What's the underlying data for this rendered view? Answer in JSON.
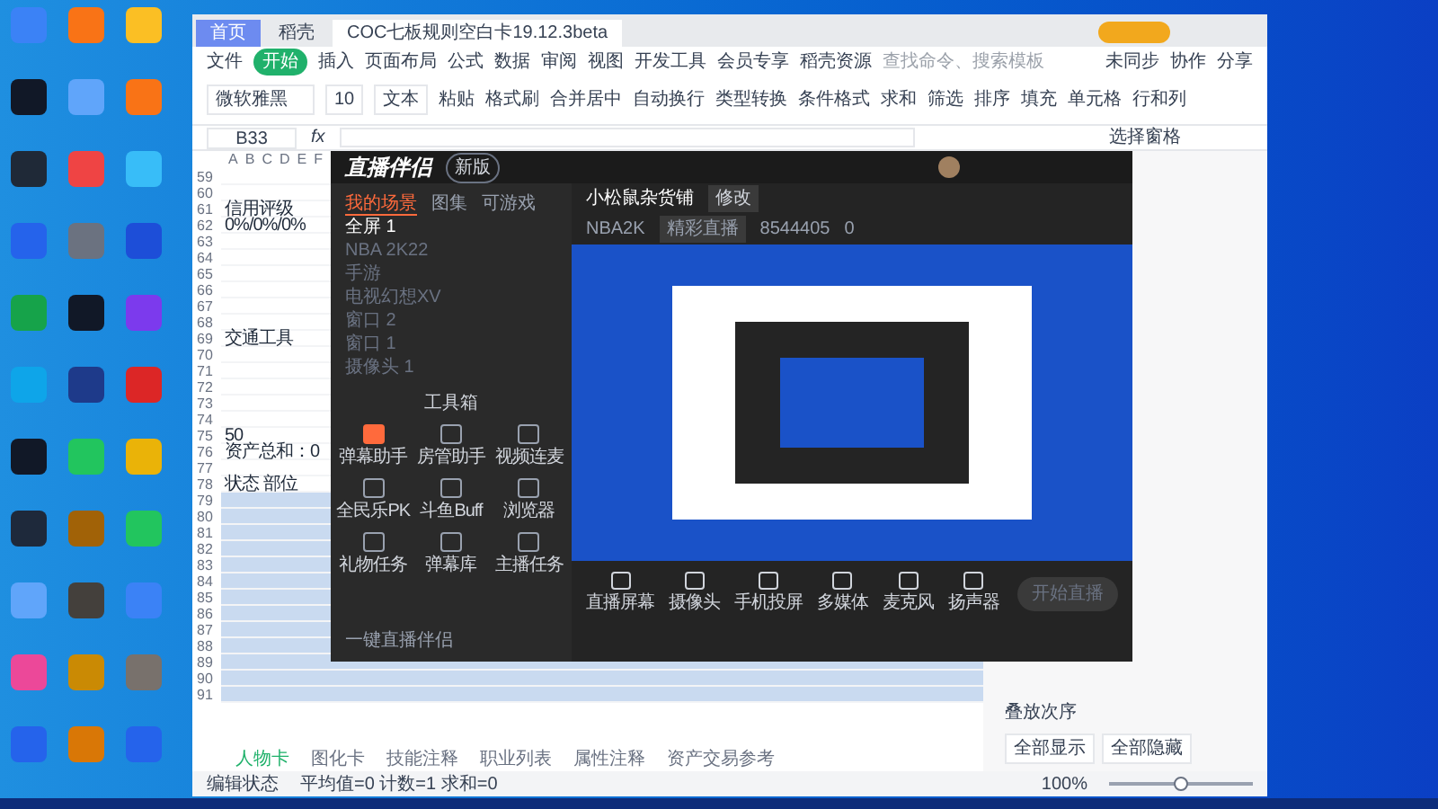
{
  "wps": {
    "tabs": [
      {
        "label": "首页",
        "selected": false
      },
      {
        "label": "稻壳",
        "selected": false
      },
      {
        "label": "COC七板规则空白卡19.12.3beta",
        "selected": true
      }
    ],
    "menu": [
      {
        "label": "文件",
        "selected": false
      },
      {
        "label": "开始",
        "selected": true
      },
      {
        "label": "插入",
        "selected": false
      },
      {
        "label": "页面布局",
        "selected": false
      },
      {
        "label": "公式",
        "selected": false
      },
      {
        "label": "数据",
        "selected": false
      },
      {
        "label": "审阅",
        "selected": false
      },
      {
        "label": "视图",
        "selected": false
      },
      {
        "label": "开发工具",
        "selected": false
      },
      {
        "label": "会员专享",
        "selected": false
      },
      {
        "label": "稻壳资源",
        "selected": false
      }
    ],
    "search": {
      "placeholder": "查找命令、搜索模板"
    },
    "actions": [
      "未同步",
      "协作",
      "分享"
    ],
    "ribbon": [
      "粘贴",
      "格式刷",
      "合并居中",
      "自动换行",
      "类型转换",
      "条件格式",
      "求和",
      "筛选",
      "排序",
      "填充",
      "单元格",
      "行和列"
    ],
    "font": "微软雅黑",
    "font_size": "10",
    "number_format": "文本",
    "name_box": "B33",
    "formula_label": "fx",
    "columns": [
      "A",
      "B",
      "C",
      "D",
      "E",
      "F"
    ],
    "rows": [
      {
        "number": "59",
        "shaded": false
      },
      {
        "number": "60",
        "shaded": false
      },
      {
        "number": "61",
        "text": "信用评级",
        "shaded": false
      },
      {
        "number": "62",
        "text": "0%/0%/0%",
        "shaded": false
      },
      {
        "number": "63",
        "shaded": false
      },
      {
        "number": "64",
        "shaded": false
      },
      {
        "number": "65",
        "shaded": false
      },
      {
        "number": "66",
        "shaded": false
      },
      {
        "number": "67",
        "shaded": false
      },
      {
        "number": "68",
        "shaded": false
      },
      {
        "number": "69",
        "text": "交通工具",
        "shaded": false
      },
      {
        "number": "70",
        "shaded": false
      },
      {
        "number": "71",
        "shaded": false
      },
      {
        "number": "72",
        "shaded": false
      },
      {
        "number": "73",
        "shaded": false
      },
      {
        "number": "74",
        "shaded": false
      },
      {
        "number": "75",
        "text": "50",
        "shaded": false
      },
      {
        "number": "76",
        "text": "资产总和：0",
        "shaded": false
      },
      {
        "number": "77",
        "shaded": false
      },
      {
        "number": "78",
        "text": "状态  部位",
        "shaded": false
      },
      {
        "number": "79",
        "shaded": true
      },
      {
        "number": "80",
        "shaded": true
      },
      {
        "number": "81",
        "shaded": true
      },
      {
        "number": "82",
        "shaded": true
      },
      {
        "number": "83",
        "shaded": true
      },
      {
        "number": "84",
        "shaded": true
      },
      {
        "number": "85",
        "shaded": true
      },
      {
        "number": "86",
        "shaded": true
      },
      {
        "number": "87",
        "shaded": true
      },
      {
        "number": "88",
        "shaded": true
      },
      {
        "number": "89",
        "shaded": true
      },
      {
        "number": "90",
        "shaded": true
      },
      {
        "number": "91",
        "shaded": true
      }
    ],
    "sheets": [
      {
        "label": "人物卡",
        "selected": true
      },
      {
        "label": "图化卡",
        "selected": false
      },
      {
        "label": "技能注释",
        "selected": false
      },
      {
        "label": "职业列表",
        "selected": false
      },
      {
        "label": "属性注释",
        "selected": false
      },
      {
        "label": "资产交易参考",
        "selected": false
      }
    ],
    "status": [
      "编辑状态",
      "平均值=0 计数=1 求和=0"
    ],
    "zoom": "100%",
    "zoom_slider": {
      "level": 0.5
    },
    "pane": {
      "title": "选择窗格",
      "order": "叠放次序",
      "buttons": [
        "全部显示",
        "全部隐藏"
      ]
    }
  },
  "live": {
    "title": "直播伴侣",
    "badge": "新版",
    "tabs": [
      {
        "label": "我的场景",
        "selected": true
      },
      {
        "label": "图集",
        "selected": false
      },
      {
        "label": "可游戏",
        "selected": false
      }
    ],
    "scenes": [
      {
        "label": "全屏 1",
        "visible": true
      },
      {
        "label": "NBA 2K22",
        "visible": false
      },
      {
        "label": "手游",
        "visible": false
      },
      {
        "label": "电视幻想XV",
        "visible": false
      },
      {
        "label": "窗口 2",
        "visible": false
      },
      {
        "label": "窗口 1",
        "visible": false
      },
      {
        "label": "摄像头 1",
        "visible": false
      }
    ],
    "toolbox_title": "工具箱",
    "tools": [
      "弹幕助手",
      "房管助手",
      "视频连麦",
      "全民乐PK",
      "斗鱼Buff",
      "浏览器",
      "礼物任务",
      "弹幕库",
      "主播任务"
    ],
    "footer": "一键直播伴侣",
    "room": {
      "name": "小松鼠杂货铺",
      "edit": "修改",
      "game": "NBA2K",
      "tag": "精彩直播",
      "id": "8544405",
      "hot": "0"
    },
    "controls": [
      "直播屏幕",
      "摄像头",
      "手机投屏",
      "多媒体",
      "麦克风",
      "扬声器"
    ],
    "start": "开始直播"
  }
}
